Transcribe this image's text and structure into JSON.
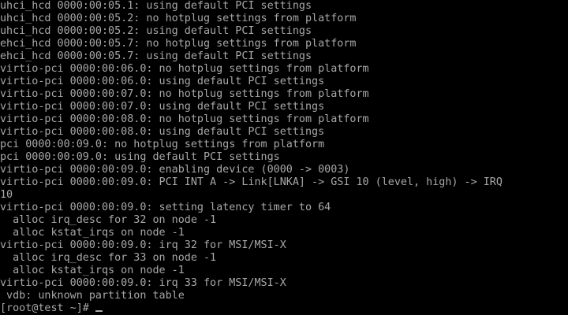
{
  "colors": {
    "background": "#000000",
    "foreground": "#a8a8a8"
  },
  "console": {
    "lines": [
      "uhci_hcd 0000:00:05.1: using default PCI settings",
      "uhci_hcd 0000:00:05.2: no hotplug settings from platform",
      "uhci_hcd 0000:00:05.2: using default PCI settings",
      "ehci_hcd 0000:00:05.7: no hotplug settings from platform",
      "ehci_hcd 0000:00:05.7: using default PCI settings",
      "virtio-pci 0000:00:06.0: no hotplug settings from platform",
      "virtio-pci 0000:00:06.0: using default PCI settings",
      "virtio-pci 0000:00:07.0: no hotplug settings from platform",
      "virtio-pci 0000:00:07.0: using default PCI settings",
      "virtio-pci 0000:00:08.0: no hotplug settings from platform",
      "virtio-pci 0000:00:08.0: using default PCI settings",
      "pci 0000:00:09.0: no hotplug settings from platform",
      "pci 0000:00:09.0: using default PCI settings",
      "virtio-pci 0000:00:09.0: enabling device (0000 -> 0003)",
      "virtio-pci 0000:00:09.0: PCI INT A -> Link[LNKA] -> GSI 10 (level, high) -> IRQ",
      "10",
      "virtio-pci 0000:00:09.0: setting latency timer to 64",
      "  alloc irq_desc for 32 on node -1",
      "  alloc kstat_irqs on node -1",
      "virtio-pci 0000:00:09.0: irq 32 for MSI/MSI-X",
      "  alloc irq_desc for 33 on node -1",
      "  alloc kstat_irqs on node -1",
      "virtio-pci 0000:00:09.0: irq 33 for MSI/MSI-X",
      " vdb: unknown partition table"
    ],
    "prompt": "[root@test ~]# "
  }
}
